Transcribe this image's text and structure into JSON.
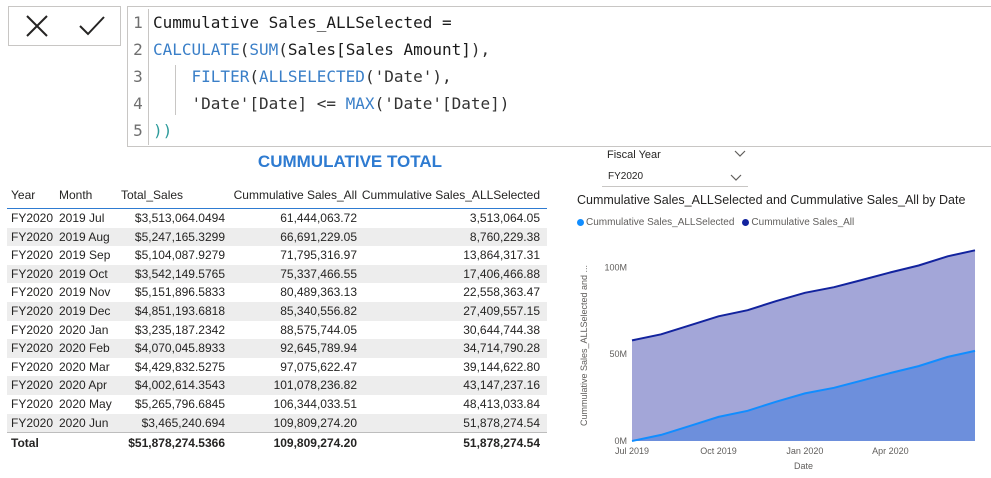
{
  "formula_bar": {
    "cancel_icon": "close-icon",
    "commit_icon": "check-icon",
    "line_numbers": [
      "1",
      "2",
      "3",
      "4",
      "5"
    ],
    "lines": [
      [
        {
          "t": "Cummulative Sales_ALLSelected =",
          "k": "txt"
        }
      ],
      [
        {
          "t": "CALCULATE",
          "k": "fn"
        },
        {
          "t": "(",
          "k": "paren"
        },
        {
          "t": "SUM",
          "k": "fn"
        },
        {
          "t": "(",
          "k": "paren"
        },
        {
          "t": "Sales[Sales Amount]",
          "k": "txt"
        },
        {
          "t": "),",
          "k": "paren"
        }
      ],
      [
        {
          "t": "    FILTER",
          "k": "fn"
        },
        {
          "t": "(",
          "k": "paren"
        },
        {
          "t": "ALLSELECTED",
          "k": "fn"
        },
        {
          "t": "(",
          "k": "paren"
        },
        {
          "t": "'Date'",
          "k": "str"
        },
        {
          "t": "),",
          "k": "paren"
        }
      ],
      [
        {
          "t": "    'Date'[Date] <= ",
          "k": "str"
        },
        {
          "t": "MAX",
          "k": "fn"
        },
        {
          "t": "(",
          "k": "paren"
        },
        {
          "t": "'Date'[Date]",
          "k": "str"
        },
        {
          "t": ")",
          "k": "paren"
        }
      ],
      [
        {
          "t": "))",
          "k": "teal"
        }
      ]
    ]
  },
  "table": {
    "title": "CUMMULATIVE TOTAL",
    "headers": {
      "year": "Year",
      "month": "Month",
      "sales": "Total_Sales",
      "all": "Cummulative Sales_All",
      "sel": "Cummulative Sales_ALLSelected"
    },
    "rows": [
      [
        "FY2020",
        "2019 Jul",
        "$3,513,064.0494",
        "61,444,063.72",
        "3,513,064.05"
      ],
      [
        "FY2020",
        "2019 Aug",
        "$5,247,165.3299",
        "66,691,229.05",
        "8,760,229.38"
      ],
      [
        "FY2020",
        "2019 Sep",
        "$5,104,087.9279",
        "71,795,316.97",
        "13,864,317.31"
      ],
      [
        "FY2020",
        "2019 Oct",
        "$3,542,149.5765",
        "75,337,466.55",
        "17,406,466.88"
      ],
      [
        "FY2020",
        "2019 Nov",
        "$5,151,896.5833",
        "80,489,363.13",
        "22,558,363.47"
      ],
      [
        "FY2020",
        "2019 Dec",
        "$4,851,193.6818",
        "85,340,556.82",
        "27,409,557.15"
      ],
      [
        "FY2020",
        "2020 Jan",
        "$3,235,187.2342",
        "88,575,744.05",
        "30,644,744.38"
      ],
      [
        "FY2020",
        "2020 Feb",
        "$4,070,045.8933",
        "92,645,789.94",
        "34,714,790.28"
      ],
      [
        "FY2020",
        "2020 Mar",
        "$4,429,832.5275",
        "97,075,622.47",
        "39,144,622.80"
      ],
      [
        "FY2020",
        "2020 Apr",
        "$4,002,614.3543",
        "101,078,236.82",
        "43,147,237.16"
      ],
      [
        "FY2020",
        "2020 May",
        "$5,265,796.6845",
        "106,344,033.51",
        "48,413,033.84"
      ],
      [
        "FY2020",
        "2020 Jun",
        "$3,465,240.694",
        "109,809,274.20",
        "51,878,274.54"
      ]
    ],
    "total": {
      "label": "Total",
      "sales": "$51,878,274.5366",
      "all": "109,809,274.20",
      "sel": "51,878,274.54"
    }
  },
  "slicer": {
    "label": "Fiscal Year",
    "selected": "FY2020"
  },
  "chart_data": {
    "type": "area",
    "title": "Cummulative Sales_ALLSelected and Cummulative Sales_All by Date",
    "xlabel": "Date",
    "ylabel": "Cummulative Sales_ALLSelected and ...",
    "x_ticks": [
      "Jul 2019",
      "Oct 2019",
      "Jan 2020",
      "Apr 2020"
    ],
    "y_ticks": [
      "0M",
      "50M",
      "100M"
    ],
    "ylim": [
      0,
      110000000
    ],
    "x": [
      "2019-07-01",
      "2019-08-01",
      "2019-09-01",
      "2019-10-01",
      "2019-11-01",
      "2019-12-01",
      "2020-01-01",
      "2020-02-01",
      "2020-03-01",
      "2020-04-01",
      "2020-05-01",
      "2020-06-01",
      "2020-06-30"
    ],
    "series": [
      {
        "name": "Cummulative Sales_ALLSelected",
        "color": "#118dff",
        "values": [
          0,
          3513064.05,
          8760229.38,
          13864317.31,
          17406466.88,
          22558363.47,
          27409557.15,
          30644744.38,
          34714790.28,
          39144622.8,
          43147237.16,
          48413033.84,
          51878274.54
        ]
      },
      {
        "name": "Cummulative Sales_All",
        "color": "#12239e",
        "values": [
          57931000,
          61444063.72,
          66691229.05,
          71795316.97,
          75337466.55,
          80489363.13,
          85340556.82,
          88575744.05,
          92645789.94,
          97075622.47,
          101078236.82,
          106344033.51,
          109809274.2
        ]
      }
    ],
    "legend_position": "top-left",
    "grid": false
  }
}
